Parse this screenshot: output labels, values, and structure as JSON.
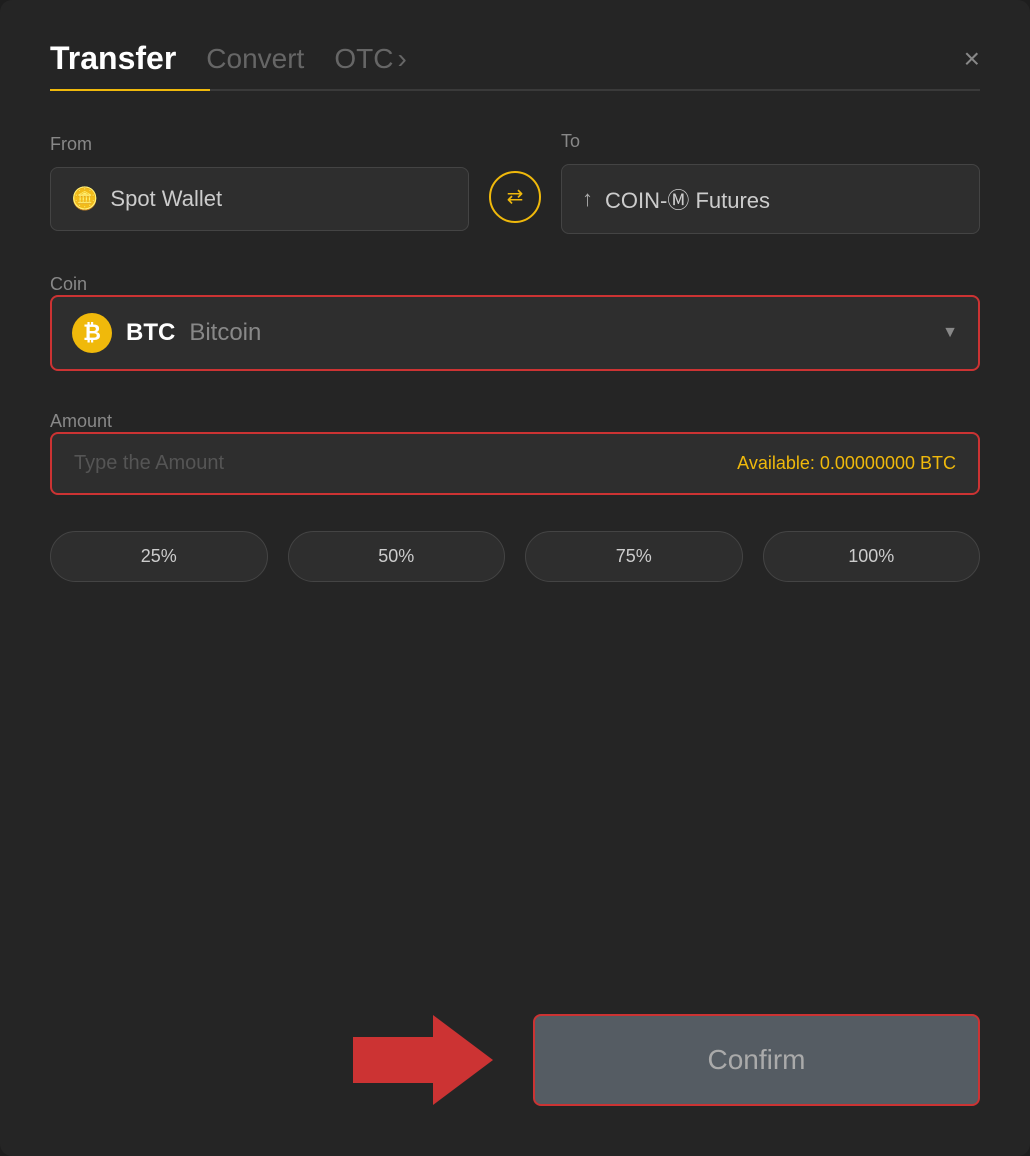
{
  "header": {
    "tab_transfer": "Transfer",
    "tab_convert": "Convert",
    "tab_otc": "OTC",
    "tab_otc_arrow": "›",
    "close_label": "×"
  },
  "from": {
    "label": "From",
    "wallet_name": "Spot Wallet"
  },
  "to": {
    "label": "To",
    "wallet_name": "COIN-Ⓜ Futures"
  },
  "coin": {
    "label": "Coin",
    "symbol": "BTC",
    "name": "Bitcoin",
    "icon_text": "₿"
  },
  "amount": {
    "label": "Amount",
    "placeholder": "Type the Amount",
    "available_label": "Available:",
    "available_value": "0.00000000 BTC"
  },
  "pct_buttons": [
    {
      "label": "25%"
    },
    {
      "label": "50%"
    },
    {
      "label": "75%"
    },
    {
      "label": "100%"
    }
  ],
  "confirm_btn": {
    "label": "Confirm"
  }
}
